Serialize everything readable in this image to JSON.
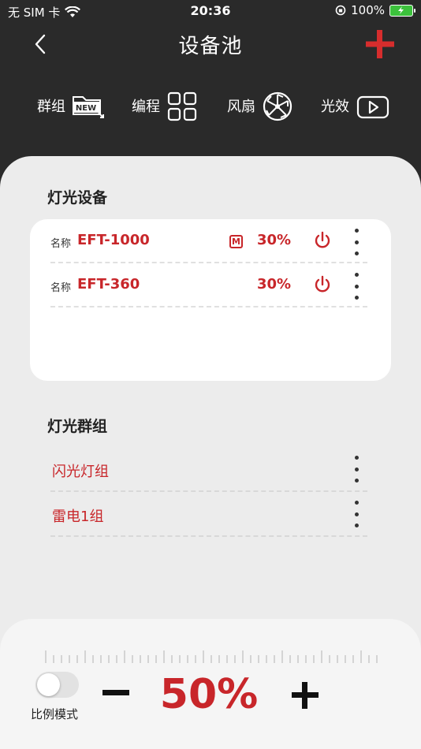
{
  "status": {
    "carrier": "无 SIM 卡",
    "time": "20:36",
    "battery": "100%"
  },
  "nav": {
    "title": "设备池"
  },
  "toolbar": {
    "group": "群组",
    "program": "编程",
    "fan": "风扇",
    "effect": "光效",
    "new_badge": "NEW"
  },
  "devices": {
    "title": "灯光设备",
    "name_label": "名称",
    "items": [
      {
        "name": "EFT-1000",
        "badge": "M",
        "percent": "30%"
      },
      {
        "name": "EFT-360",
        "percent": "30%"
      }
    ]
  },
  "groups": {
    "title": "灯光群组",
    "items": [
      {
        "name": "闪光灯组"
      },
      {
        "name": "雷电1组"
      }
    ]
  },
  "control": {
    "mode_label": "比例模式",
    "mode_on": false,
    "value": "50%"
  },
  "colors": {
    "accent": "#c8262a",
    "header_bg": "#2a2a2a",
    "sheet_bg": "#ececec"
  }
}
